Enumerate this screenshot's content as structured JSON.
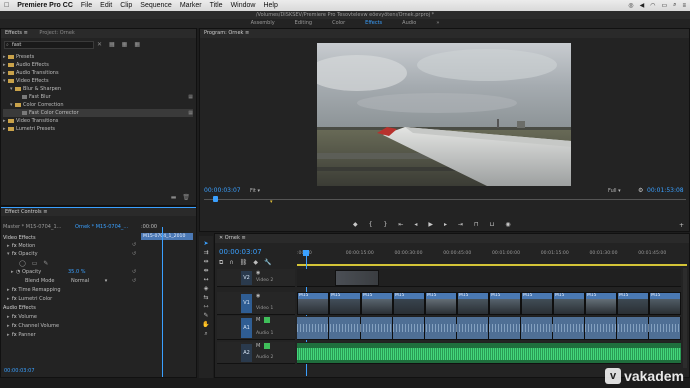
{
  "menubar": {
    "app": "Premiere Pro CC",
    "items": [
      "File",
      "Edit",
      "Clip",
      "Sequence",
      "Marker",
      "Title",
      "Window",
      "Help"
    ]
  },
  "titlebar": {
    "path": "/Volumes/DISKSEV/Premiere Pro Tesovtelevw eöevyötenı/Ornek.prproj *"
  },
  "workspaces": {
    "tabs": [
      "Assembly",
      "Editing",
      "Color",
      "Effects",
      "Audio"
    ],
    "active": "Effects"
  },
  "effects_panel": {
    "tab1": "Effects",
    "tab2": "Project: Ornek",
    "search_value": "fast",
    "tree": [
      {
        "label": "Presets",
        "level": 0,
        "kind": "folder",
        "expanded": false
      },
      {
        "label": "Audio Effects",
        "level": 0,
        "kind": "folder",
        "expanded": false
      },
      {
        "label": "Audio Transitions",
        "level": 0,
        "kind": "folder",
        "expanded": false
      },
      {
        "label": "Video Effects",
        "level": 0,
        "kind": "folder",
        "expanded": true
      },
      {
        "label": "Blur & Sharpen",
        "level": 1,
        "kind": "folder",
        "expanded": true
      },
      {
        "label": "Fast Blur",
        "level": 2,
        "kind": "effect",
        "expanded": false
      },
      {
        "label": "Color Correction",
        "level": 1,
        "kind": "folder",
        "expanded": true
      },
      {
        "label": "Fast Color Corrector",
        "level": 2,
        "kind": "effect",
        "expanded": false,
        "selected": true
      },
      {
        "label": "Video Transitions",
        "level": 0,
        "kind": "folder",
        "expanded": false
      },
      {
        "label": "Lumetri Presets",
        "level": 0,
        "kind": "folder",
        "expanded": false
      }
    ]
  },
  "effect_controls": {
    "tab": "Effect Controls",
    "master": "Master * M15-0704_1...",
    "sequence": "Ornek * M15-0704_...",
    "timecode_label": ":00:00",
    "clip_bar": "M15-0704_1_2010",
    "video_effects_label": "Video Effects",
    "motion": "Motion",
    "opacity": "Opacity",
    "opacity_param": "Opacity",
    "opacity_value": "35.0 %",
    "blend_mode_label": "Blend Mode",
    "blend_mode_value": "Normal",
    "time_remapping": "Time Remapping",
    "lumetri_color": "Lumetri Color",
    "audio_effects_label": "Audio Effects",
    "volume": "Volume",
    "channel_volume": "Channel Volume",
    "panner": "Panner",
    "timecode": "00:00:03:07"
  },
  "program": {
    "title": "Program: Ornek",
    "timecode": "00:00:03:07",
    "fit": "Fit",
    "quality": "Full",
    "duration": "00:01:53:08"
  },
  "timeline": {
    "title": "Ornek",
    "timecode": "00:00:03:07",
    "ruler": [
      ":00:00",
      "00:00:15:00",
      "00:00:30:00",
      "00:00:45:00",
      "00:01:00:00",
      "00:01:15:00",
      "00:01:30:00",
      "00:01:45:00"
    ],
    "tracks": [
      {
        "id": "V2",
        "name": "Video 2"
      },
      {
        "id": "V1",
        "name": "Video 1"
      },
      {
        "id": "A1",
        "name": "Audio 1"
      },
      {
        "id": "A2",
        "name": "Audio 2"
      }
    ],
    "clip_label": "M15"
  },
  "watermark": "vakadem"
}
